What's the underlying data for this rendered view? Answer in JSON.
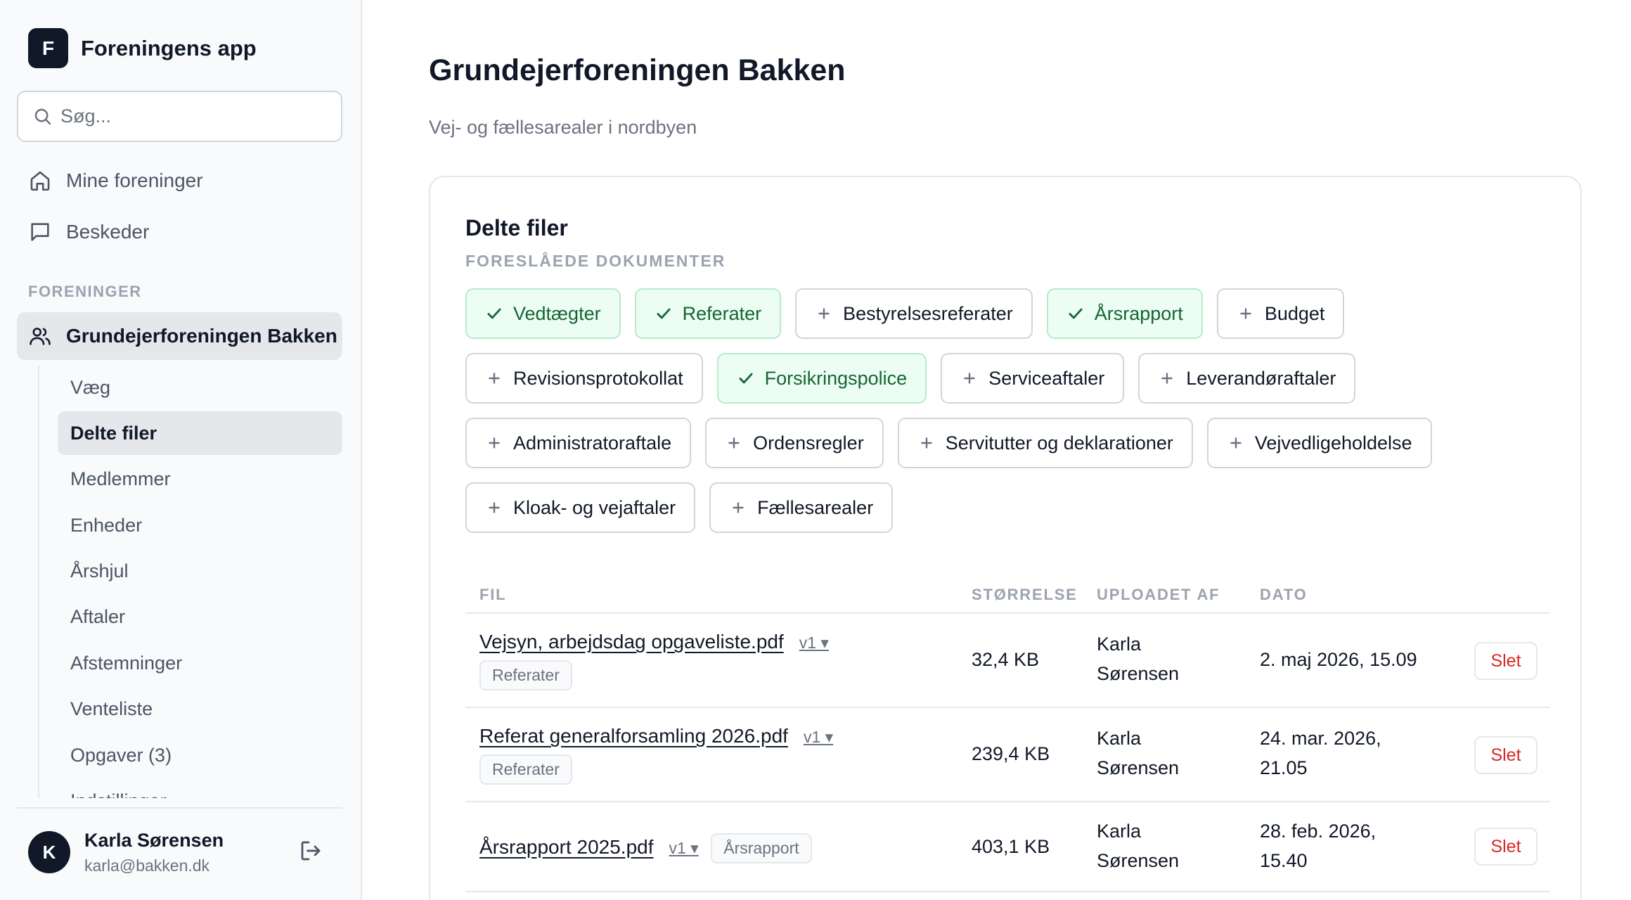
{
  "app": {
    "logo_letter": "F",
    "name": "Foreningens app"
  },
  "search": {
    "placeholder": "Søg..."
  },
  "nav": {
    "my_associations": "Mine foreninger",
    "messages": "Beskeder"
  },
  "sidebar": {
    "section_label": "FORENINGER",
    "active_org": "Grundejerforeningen Bakken",
    "subnav": [
      "Væg",
      "Delte filer",
      "Medlemmer",
      "Enheder",
      "Årshjul",
      "Aftaler",
      "Afstemninger",
      "Venteliste",
      "Opgaver (3)",
      "Indstillinger"
    ]
  },
  "user": {
    "initial": "K",
    "name": "Karla Sørensen",
    "email": "karla@bakken.dk"
  },
  "page": {
    "title": "Grundejerforeningen Bakken",
    "subtitle": "Vej- og fællesarealer i nordbyen"
  },
  "files_card": {
    "title": "Delte filer",
    "suggested_label": "FORESLÅEDE DOKUMENTER",
    "chips": [
      {
        "label": "Vedtægter",
        "selected": true
      },
      {
        "label": "Referater",
        "selected": true
      },
      {
        "label": "Bestyrelsesreferater",
        "selected": false
      },
      {
        "label": "Årsrapport",
        "selected": true
      },
      {
        "label": "Budget",
        "selected": false
      },
      {
        "label": "Revisionsprotokollat",
        "selected": false
      },
      {
        "label": "Forsikringspolice",
        "selected": true
      },
      {
        "label": "Serviceaftaler",
        "selected": false
      },
      {
        "label": "Leverandøraftaler",
        "selected": false
      },
      {
        "label": "Administratoraftale",
        "selected": false
      },
      {
        "label": "Ordensregler",
        "selected": false
      },
      {
        "label": "Servitutter og deklarationer",
        "selected": false
      },
      {
        "label": "Vejvedligeholdelse",
        "selected": false
      },
      {
        "label": "Kloak- og vejaftaler",
        "selected": false
      },
      {
        "label": "Fællesarealer",
        "selected": false
      }
    ],
    "columns": {
      "file": "FIL",
      "size": "STØRRELSE",
      "uploaded_by": "UPLOADET AF",
      "date": "DATO"
    },
    "delete_label": "Slet",
    "rows": [
      {
        "file": "Vejsyn, arbejdsdag opgaveliste.pdf",
        "version": "v1 ▾",
        "tag": "Referater",
        "size": "32,4 KB",
        "uploader_first": "Karla",
        "uploader_last": "Sørensen",
        "date_line1": "2. maj 2026, 15.09",
        "date_line2": ""
      },
      {
        "file": "Referat generalforsamling 2026.pdf",
        "version": "v1 ▾",
        "tag": "Referater",
        "size": "239,4 KB",
        "uploader_first": "Karla",
        "uploader_last": "Sørensen",
        "date_line1": "24. mar. 2026,",
        "date_line2": "21.05"
      },
      {
        "file": "Årsrapport 2025.pdf",
        "version": "v1 ▾",
        "tag": "Årsrapport",
        "size": "403,1 KB",
        "uploader_first": "Karla",
        "uploader_last": "Sørensen",
        "date_line1": "28. feb. 2026,",
        "date_line2": "15.40"
      }
    ]
  },
  "colors": {
    "accent_dark": "#111827",
    "selected_bg": "#ecfdf3",
    "selected_text": "#166534",
    "danger": "#dc2626"
  }
}
